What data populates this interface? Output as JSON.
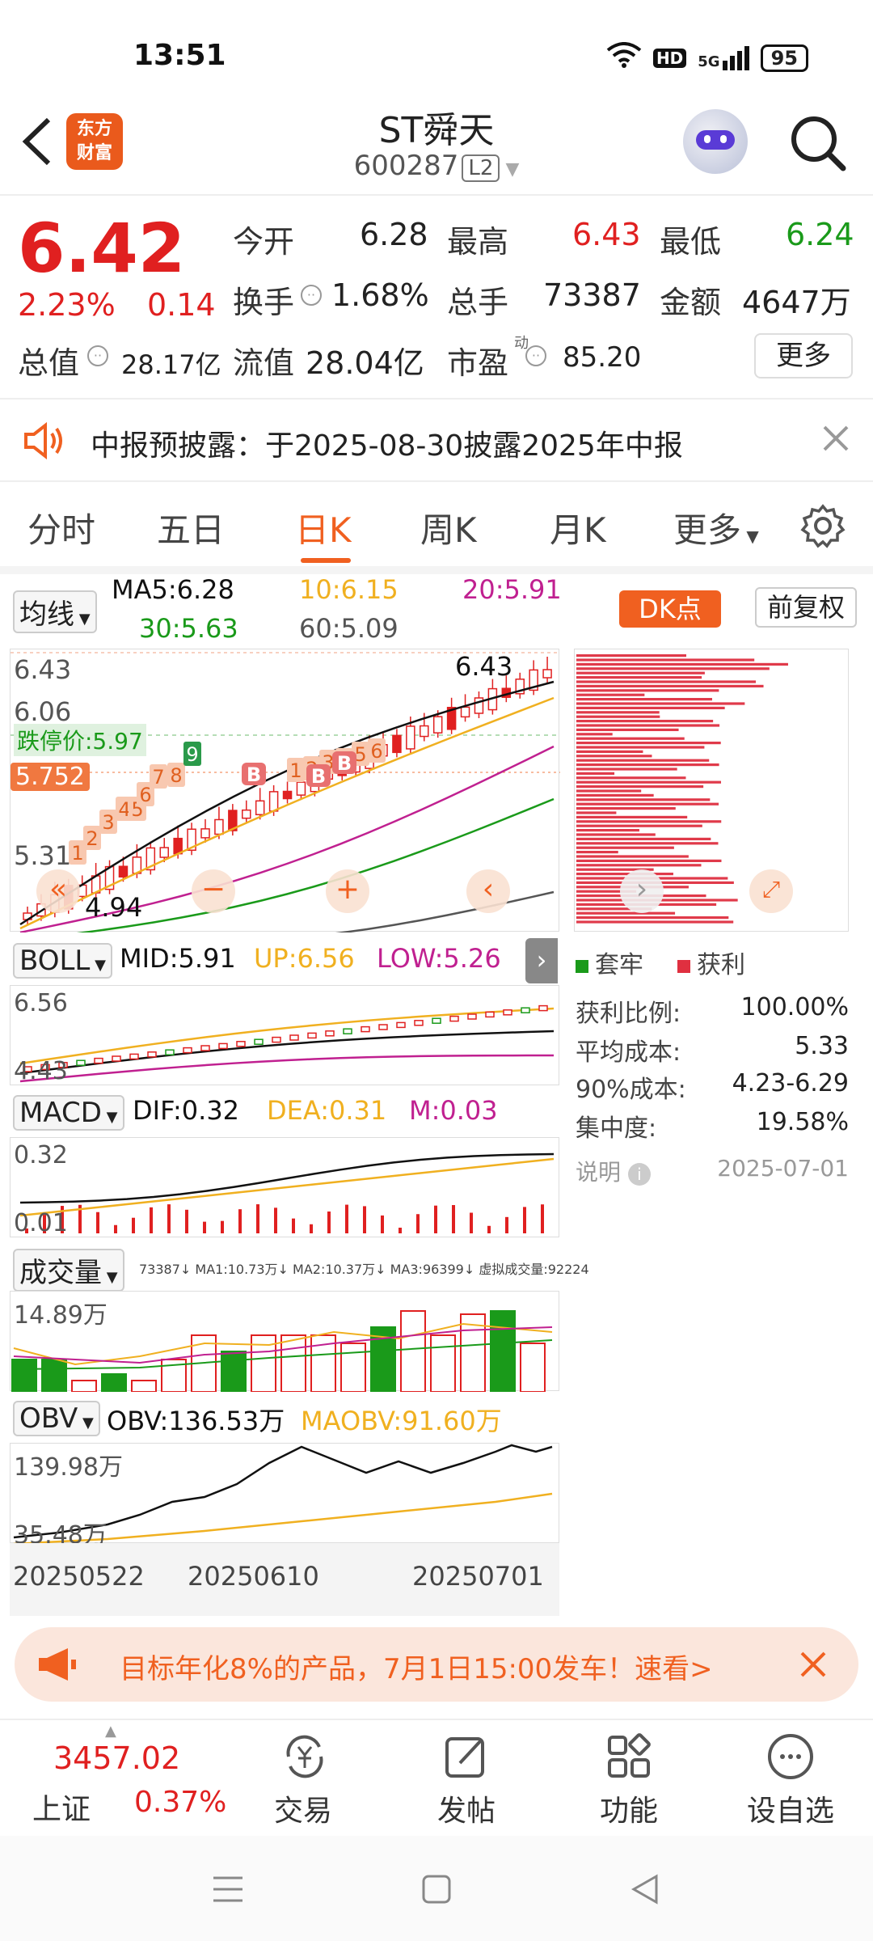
{
  "status": {
    "time": "13:51",
    "network": "5G",
    "hd": "HD",
    "battery": "95"
  },
  "header": {
    "name": "ST舜天",
    "code": "600287",
    "level": "L2",
    "logo_top": "东方",
    "logo_bottom": "财富"
  },
  "quote": {
    "price": "6.42",
    "change_pct": "2.23%",
    "change": "0.14",
    "open_label": "今开",
    "open": "6.28",
    "high_label": "最高",
    "high": "6.43",
    "low_label": "最低",
    "low": "6.24",
    "turnover_label": "换手",
    "turnover": "1.68%",
    "volume_label": "总手",
    "volume": "73387",
    "amount_label": "金额",
    "amount": "4647万",
    "mcap_label": "总值",
    "mcap": "28.17亿",
    "float_label": "流值",
    "float": "28.04亿",
    "pe_label": "市盈",
    "pe_sup": "动",
    "pe": "85.20",
    "more_label": "更多"
  },
  "notice": {
    "text": "中报预披露：于2025-08-30披露2025年中报"
  },
  "tabs": [
    "分时",
    "五日",
    "日K",
    "周K",
    "月K",
    "更多"
  ],
  "active_tab": "日K",
  "ma_bar": {
    "selector": "均线",
    "ma5": "MA5:6.28",
    "ma10": "10:6.15",
    "ma20": "20:5.91",
    "ma30": "30:5.63",
    "ma60": "60:5.09",
    "dk": "DK点",
    "fq": "前复权"
  },
  "kline": {
    "ticks": [
      "6.43",
      "6.06",
      "5.31",
      "4.94"
    ],
    "limit_down": "跌停价:5.97",
    "cursor_price": "5.752",
    "high_label": "6.43",
    "low_label": "4.94",
    "seq_numbers": [
      "1",
      "2",
      "3",
      "4",
      "5",
      "6",
      "7",
      "8",
      "9"
    ],
    "seq_numbers_2": [
      "1",
      "2",
      "3",
      "4",
      "5",
      "6"
    ],
    "b_markers": [
      "B",
      "B",
      "B"
    ]
  },
  "chip": {
    "legend_trapped": "套牢",
    "legend_profit": "获利",
    "rows": [
      {
        "label": "获利比例:",
        "value": "100.00%"
      },
      {
        "label": "平均成本:",
        "value": "5.33"
      },
      {
        "label": "90%成本:",
        "value": "4.23-6.29"
      },
      {
        "label": "集中度:",
        "value": "19.58%"
      }
    ],
    "note_label": "说明",
    "date": "2025-07-01"
  },
  "boll": {
    "selector": "BOLL",
    "mid": "MID:5.91",
    "up": "UP:6.56",
    "low": "LOW:5.26",
    "tick_top": "6.56",
    "tick_bottom": "4.43"
  },
  "macd": {
    "selector": "MACD",
    "dif": "DIF:0.32",
    "dea": "DEA:0.31",
    "m": "M:0.03",
    "tick_top": "0.32",
    "tick_bottom": "0.01"
  },
  "vol": {
    "selector": "成交量",
    "summary": "73387↓ MA1:10.73万↓ MA2:10.37万↓ MA3:96399↓ 虚拟成交量:92224",
    "tick_top": "14.89万"
  },
  "obv": {
    "selector": "OBV",
    "obv": "OBV:136.53万",
    "maobv": "MAOBV:91.60万",
    "tick_top": "139.98万",
    "tick_bottom": "35.48万"
  },
  "dates": [
    "20250522",
    "20250610",
    "20250701"
  ],
  "ad": {
    "text": "目标年化8%的产品，7月1日15:00发车！速看>"
  },
  "bottom": {
    "index_value": "3457.02",
    "index_name": "上证",
    "index_pct": "0.37%",
    "items": [
      "交易",
      "发帖",
      "功能",
      "设自选"
    ]
  },
  "colors": {
    "up": "#e02020",
    "down": "#1a9a1a",
    "accent": "#f06020",
    "ma5": "#111111",
    "ma10": "#f0b020",
    "ma20": "#c02090",
    "ma30": "#1a9a1a",
    "ma60": "#555555"
  }
}
